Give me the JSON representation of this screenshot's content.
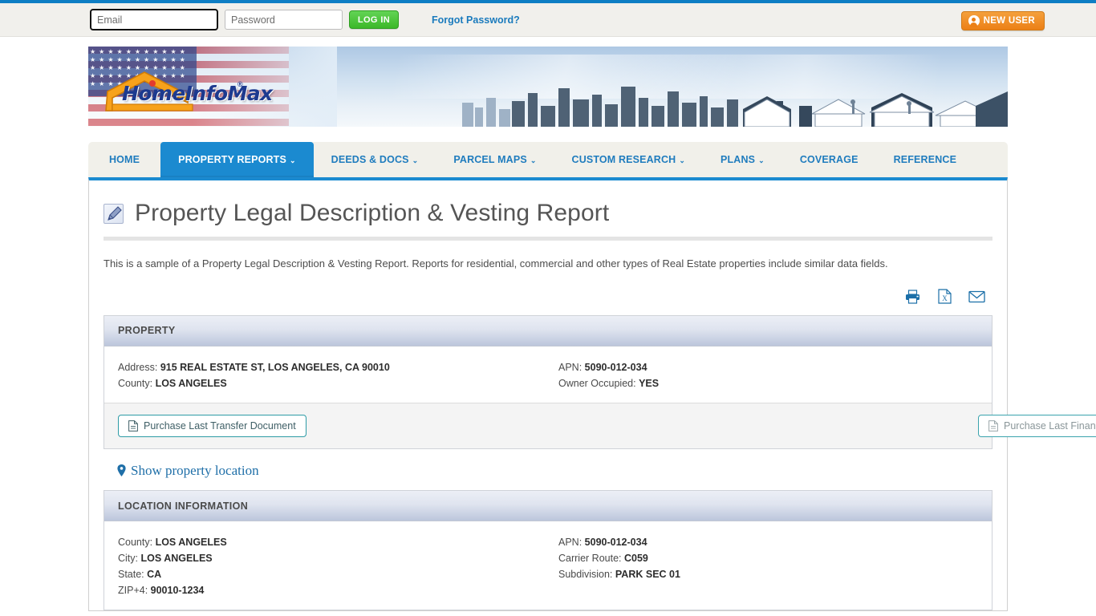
{
  "topbar": {
    "email_placeholder": "Email",
    "email_value": "",
    "password_placeholder": "Password",
    "password_value": "",
    "login_label": "LOG IN",
    "forgot_label": "Forgot Password?",
    "new_user_label": "NEW USER"
  },
  "brand": {
    "logo_text": "HomeInfoMax",
    "registered_mark": "®",
    "stars": "★★★★★★★★★★★★★★★★★★★★★★★★★★★★★★★★★★★★★★★★★★★★★★★★"
  },
  "nav": {
    "items": [
      {
        "label": "HOME",
        "caret": "",
        "active": false
      },
      {
        "label": "PROPERTY REPORTS",
        "caret": "⌄",
        "active": true
      },
      {
        "label": "DEEDS & DOCS",
        "caret": "⌄",
        "active": false
      },
      {
        "label": "PARCEL MAPS",
        "caret": "⌄",
        "active": false
      },
      {
        "label": "CUSTOM RESEARCH",
        "caret": "⌄",
        "active": false
      },
      {
        "label": "PLANS",
        "caret": "⌄",
        "active": false
      },
      {
        "label": "COVERAGE",
        "caret": "",
        "active": false
      },
      {
        "label": "REFERENCE",
        "caret": "",
        "active": false
      }
    ]
  },
  "page": {
    "title": "Property Legal Description & Vesting Report",
    "intro": "This is a sample of a Property Legal Description & Vesting Report. Reports for residential, commercial and other types of Real Estate properties include similar data fields."
  },
  "actions": {
    "print": "print-icon",
    "excel": "excel-icon",
    "email": "email-icon"
  },
  "property_section": {
    "heading": "PROPERTY",
    "left": [
      {
        "label": "Address:",
        "value": "915 REAL ESTATE ST, LOS ANGELES, CA 90010"
      },
      {
        "label": "County:",
        "value": "LOS ANGELES"
      }
    ],
    "right": [
      {
        "label": "APN:",
        "value": "5090-012-034"
      },
      {
        "label": "Owner Occupied:",
        "value": "YES"
      }
    ],
    "transfer_doc_button": "Purchase Last Transfer Document",
    "finance_doc_button": "Purchase Last Finance Document"
  },
  "show_location_link": "Show property location",
  "location_section": {
    "heading": "LOCATION INFORMATION",
    "left": [
      {
        "label": "County:",
        "value": "LOS ANGELES"
      },
      {
        "label": "City:",
        "value": "LOS ANGELES"
      },
      {
        "label": "State:",
        "value": "CA"
      },
      {
        "label": "ZIP+4:",
        "value": "90010-1234"
      }
    ],
    "right": [
      {
        "label": "APN:",
        "value": "5090-012-034"
      },
      {
        "label": "Carrier Route:",
        "value": "C059"
      },
      {
        "label": "Subdivision:",
        "value": "PARK SEC 01"
      }
    ]
  },
  "colors": {
    "accent_blue": "#1b8ad0",
    "link_blue": "#1f7cbe",
    "login_green": "#3cb829",
    "new_user_orange": "#ec8016",
    "doc_btn_teal": "#2e9ba6"
  }
}
